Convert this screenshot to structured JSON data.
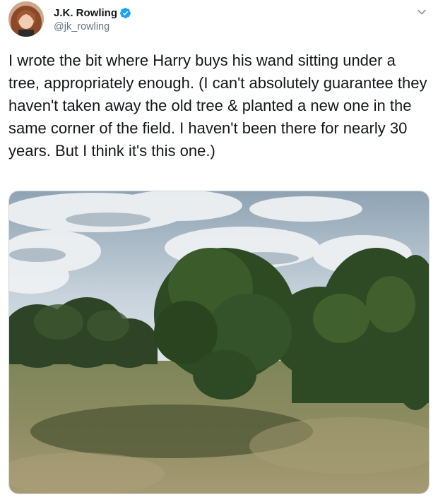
{
  "author": {
    "display_name": "J.K. Rowling",
    "handle": "@jk_rowling",
    "verified": true
  },
  "icons": {
    "verified": "verified-badge-icon",
    "menu": "chevron-down-icon"
  },
  "tweet": {
    "text": "I wrote the bit where Harry buys his wand sitting under a tree, appropriately enough. (I can't absolutely guarantee they haven't taken away the old tree & planted a new one in the same corner of the field. I haven't been there for nearly 30 years. But I think it's this one.)"
  },
  "colors": {
    "verified_blue": "#1da1f2",
    "handle_gray": "#657786",
    "text": "#14171a"
  }
}
